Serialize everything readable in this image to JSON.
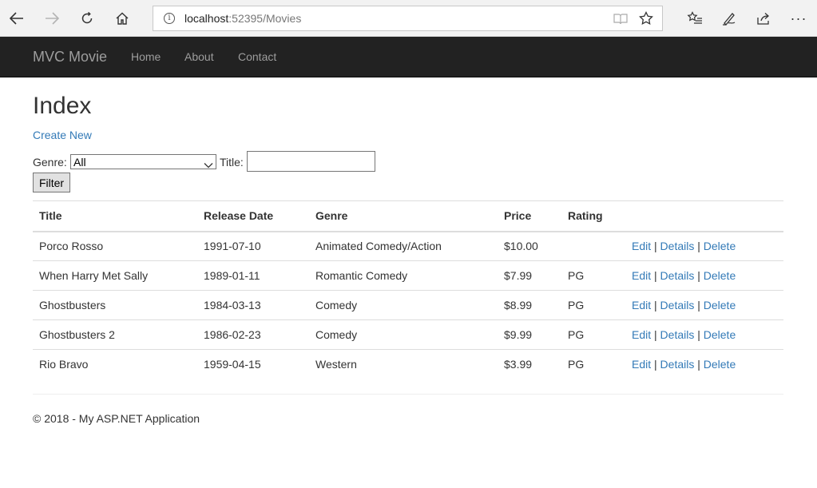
{
  "browser": {
    "url_host": "localhost",
    "url_rest": ":52395/Movies",
    "more_label": "···"
  },
  "icons": {
    "back": "back-arrow-icon",
    "forward": "forward-arrow-icon",
    "refresh": "refresh-icon",
    "home": "home-icon",
    "site_info": "info-icon",
    "reading_view": "book-icon",
    "favorite": "star-icon",
    "favorites_hub": "favorites-list-icon",
    "notes": "pen-icon",
    "share": "share-icon",
    "more": "more-dots-icon"
  },
  "navbar": {
    "brand": "MVC Movie",
    "links": [
      "Home",
      "About",
      "Contact"
    ]
  },
  "main": {
    "title": "Index",
    "create_link": "Create New",
    "filter": {
      "genre_label": "Genre:",
      "genre_selected": "All",
      "title_label": "Title:",
      "title_value": "",
      "button_label": "Filter"
    },
    "table": {
      "headers": [
        "Title",
        "Release Date",
        "Genre",
        "Price",
        "Rating",
        ""
      ],
      "rows": [
        {
          "title": "Porco Rosso",
          "release_date": "1991-07-10",
          "genre": "Animated Comedy/Action",
          "price": "$10.00",
          "rating": ""
        },
        {
          "title": "When Harry Met Sally",
          "release_date": "1989-01-11",
          "genre": "Romantic Comedy",
          "price": "$7.99",
          "rating": "PG"
        },
        {
          "title": "Ghostbusters",
          "release_date": "1984-03-13",
          "genre": "Comedy",
          "price": "$8.99",
          "rating": "PG"
        },
        {
          "title": "Ghostbusters 2",
          "release_date": "1986-02-23",
          "genre": "Comedy",
          "price": "$9.99",
          "rating": "PG"
        },
        {
          "title": "Rio Bravo",
          "release_date": "1959-04-15",
          "genre": "Western",
          "price": "$3.99",
          "rating": "PG"
        }
      ],
      "actions": {
        "edit": "Edit",
        "details": "Details",
        "delete": "Delete",
        "separator": "|"
      }
    }
  },
  "footer": {
    "text": "© 2018 - My ASP.NET Application"
  },
  "colors": {
    "navbar_bg": "#222222",
    "nav_text": "#9d9d9d",
    "link": "#337ab7",
    "body_text": "#333333"
  }
}
